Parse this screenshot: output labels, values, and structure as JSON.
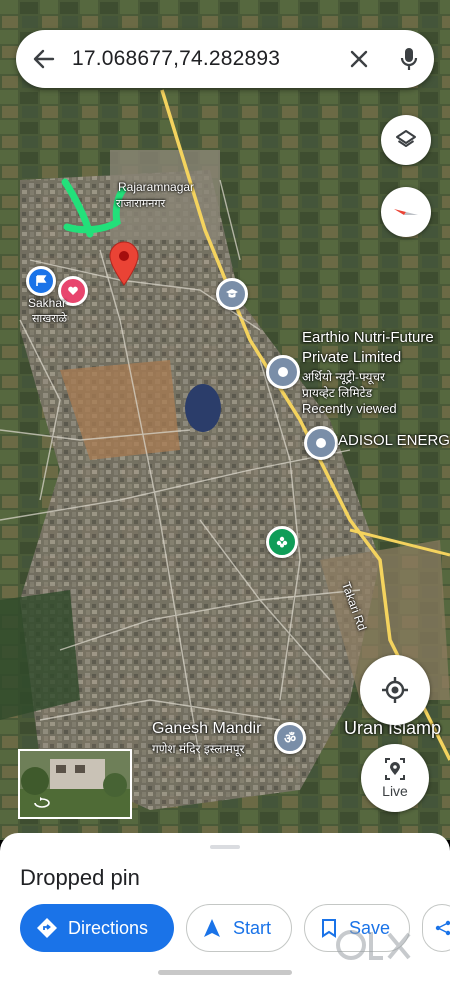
{
  "search": {
    "query": "17.068677,74.282893"
  },
  "map_labels": {
    "rajaramnagar_en": "Rajaramnagar",
    "rajaramnagar_mr": "राजारामनगर",
    "sakharale_en": "Sakhar",
    "sakharale_mr": "साखराळे",
    "earthio_line1": "Earthio Nutri-Future",
    "earthio_line2": "Private Limited",
    "earthio_mr1": "अर्थियो न्यूट्री-फ्यूचर",
    "earthio_mr2": "प्रायव्हेट लिमिटेड",
    "recently_viewed": "Recently viewed",
    "adisol": "ADISOL ENERG",
    "takari_rd": "Takari Rd",
    "ganesh_en": "Ganesh Mandir",
    "ganesh_mr": "गणेश मंदिर इस्लामपूर",
    "uran": "Uran Islamp"
  },
  "controls": {
    "live_label": "Live"
  },
  "sheet": {
    "title": "Dropped pin",
    "directions_label": "Directions",
    "start_label": "Start",
    "save_label": "Save"
  },
  "watermark": {
    "brand": "OLX"
  },
  "colors": {
    "accent": "#1a73e8",
    "pin": "#ea4335",
    "road": "#f4d35e"
  }
}
